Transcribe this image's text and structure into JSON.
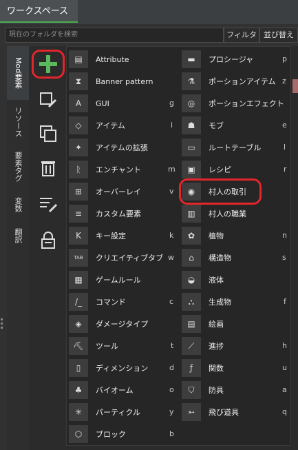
{
  "workspace_tab": "ワークスペース",
  "search": {
    "placeholder": "現在のフォルダを検索"
  },
  "filter_label": "フィルタ",
  "sort_label": "並び替え",
  "vertical_tabs": [
    "Mod要素",
    "リソース",
    "要素タグ",
    "変数",
    "翻訳"
  ],
  "menu_left": [
    {
      "label": "Attribute",
      "key": "",
      "icon": "attribute-icon"
    },
    {
      "label": "Banner pattern",
      "key": "",
      "icon": "banner-pattern-icon"
    },
    {
      "label": "GUI",
      "key": "g",
      "icon": "gui-icon"
    },
    {
      "label": "アイテム",
      "key": "i",
      "icon": "diamond-icon"
    },
    {
      "label": "アイテムの拡張",
      "key": "",
      "icon": "item-extension-icon"
    },
    {
      "label": "エンチャント",
      "key": "m",
      "icon": "enchantment-icon"
    },
    {
      "label": "オーバーレイ",
      "key": "v",
      "icon": "overlay-icon"
    },
    {
      "label": "カスタム要素",
      "key": "",
      "icon": "custom-element-icon"
    },
    {
      "label": "キー設定",
      "key": "k",
      "icon": "keybinding-icon"
    },
    {
      "label": "クリエイティブタブ",
      "key": "w",
      "icon": "tab-icon"
    },
    {
      "label": "ゲームルール",
      "key": "",
      "icon": "gamerule-icon"
    },
    {
      "label": "コマンド",
      "key": "c",
      "icon": "command-icon"
    },
    {
      "label": "ダメージタイプ",
      "key": "",
      "icon": "damage-type-icon"
    },
    {
      "label": "ツール",
      "key": "t",
      "icon": "pickaxe-icon"
    },
    {
      "label": "ディメンション",
      "key": "d",
      "icon": "dimension-icon"
    },
    {
      "label": "バイオーム",
      "key": "o",
      "icon": "biome-icon"
    },
    {
      "label": "パーティクル",
      "key": "y",
      "icon": "particle-icon"
    },
    {
      "label": "ブロック",
      "key": "b",
      "icon": "block-icon"
    }
  ],
  "menu_right": [
    {
      "label": "プロシージャ",
      "key": "p",
      "icon": "folder-icon"
    },
    {
      "label": "ポーションアイテム",
      "key": "z",
      "icon": "flask-icon"
    },
    {
      "label": "ポーションエフェクト",
      "key": "",
      "icon": "effect-icon"
    },
    {
      "label": "モブ",
      "key": "e",
      "icon": "mob-icon"
    },
    {
      "label": "ルートテーブル",
      "key": "l",
      "icon": "loot-table-icon"
    },
    {
      "label": "レシピ",
      "key": "r",
      "icon": "recipe-icon"
    },
    {
      "label": "村人の取引",
      "key": "",
      "icon": "villager-trade-icon"
    },
    {
      "label": "村人の職業",
      "key": "",
      "icon": "villager-profession-icon"
    },
    {
      "label": "植物",
      "key": "n",
      "icon": "plant-icon"
    },
    {
      "label": "構造物",
      "key": "s",
      "icon": "structure-icon"
    },
    {
      "label": "液体",
      "key": "",
      "icon": "fluid-icon"
    },
    {
      "label": "生成物",
      "key": "f",
      "icon": "feature-icon"
    },
    {
      "label": "絵画",
      "key": "",
      "icon": "painting-icon"
    },
    {
      "label": "進捗",
      "key": "h",
      "icon": "advancement-icon"
    },
    {
      "label": "関数",
      "key": "u",
      "icon": "function-icon"
    },
    {
      "label": "防具",
      "key": "a",
      "icon": "armor-icon"
    },
    {
      "label": "飛び道具",
      "key": "q",
      "icon": "projectile-icon"
    }
  ],
  "colors": {
    "accent": "#4caf50",
    "highlight": "#e3262b"
  }
}
